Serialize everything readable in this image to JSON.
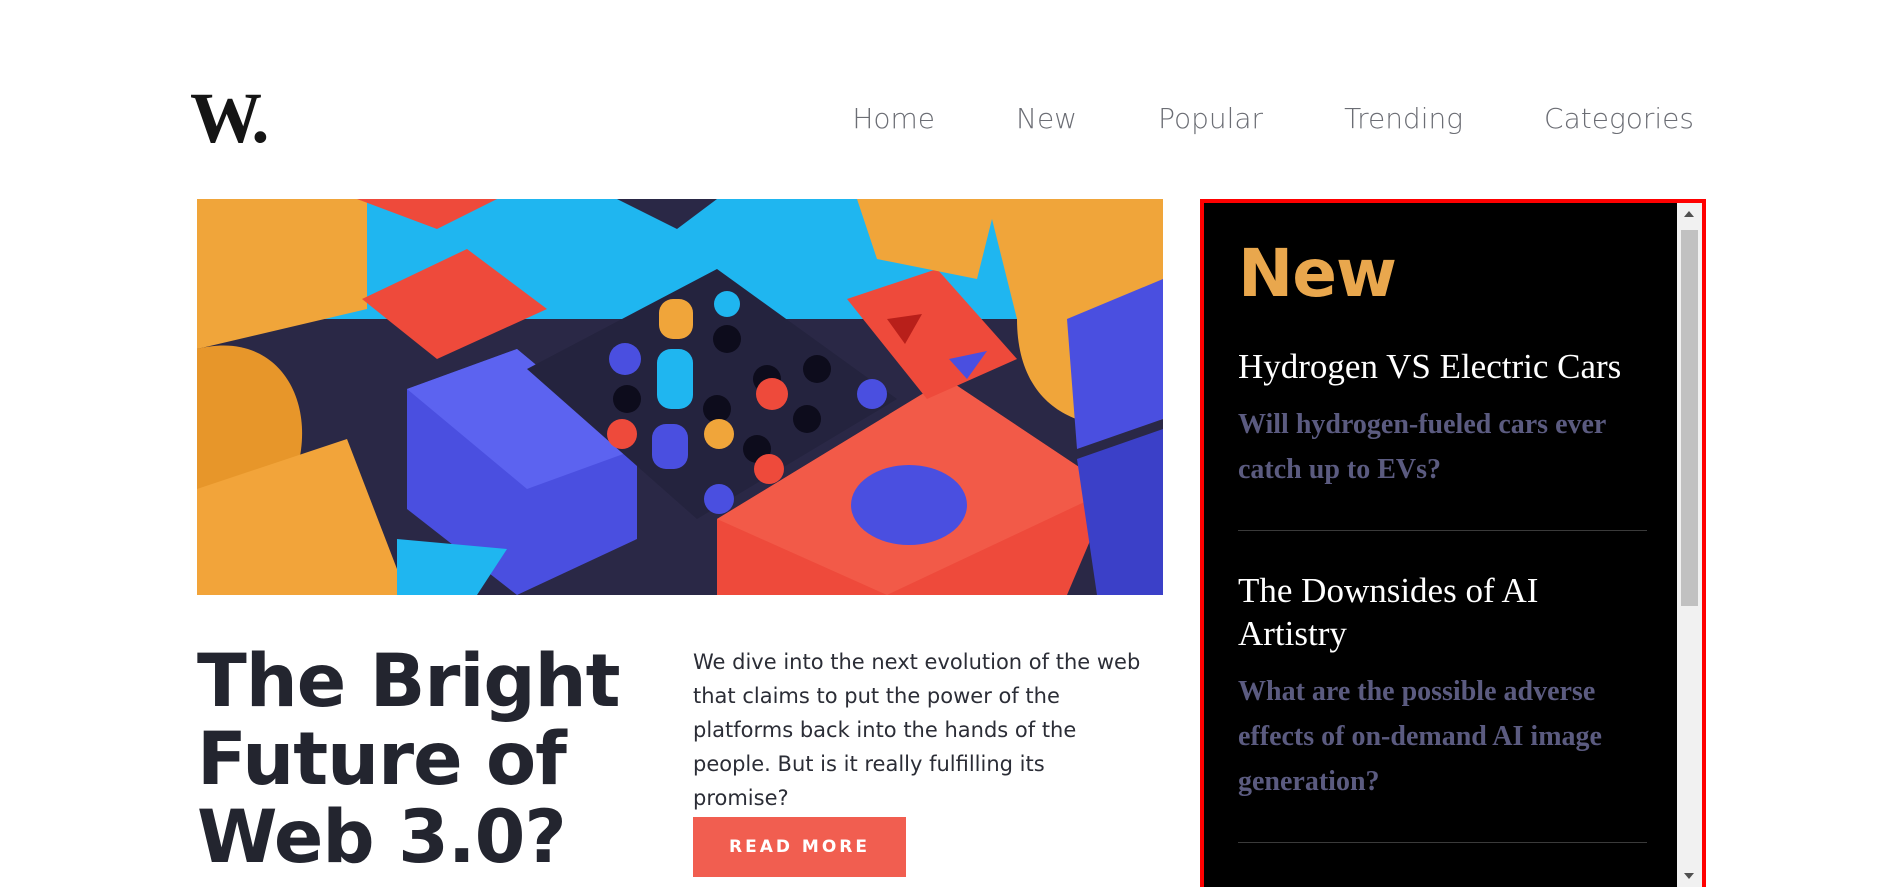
{
  "logo": "W.",
  "nav": {
    "items": [
      {
        "label": "Home"
      },
      {
        "label": "New"
      },
      {
        "label": "Popular"
      },
      {
        "label": "Trending"
      },
      {
        "label": "Categories"
      }
    ]
  },
  "hero": {
    "headline": "The Bright Future of Web 3.0?",
    "description": "We dive into the next evolution of the web that claims to put the power of the platforms back into the hands of the people. But is it really fulfilling its promise?",
    "button_label": "READ MORE"
  },
  "sidebar": {
    "heading": "New",
    "posts": [
      {
        "title": "Hydrogen VS Electric Cars",
        "subtitle": "Will hydrogen-fueled cars ever catch up to EVs?"
      },
      {
        "title": "The Downsides of AI Artistry",
        "subtitle": "What are the possible adverse effects of on-demand AI image generation?"
      }
    ]
  },
  "colors": {
    "accent": "#f15e50",
    "sidebar_heading": "#e9a74d",
    "sidebar_bg": "#000000",
    "highlight_border": "#ff0000"
  }
}
